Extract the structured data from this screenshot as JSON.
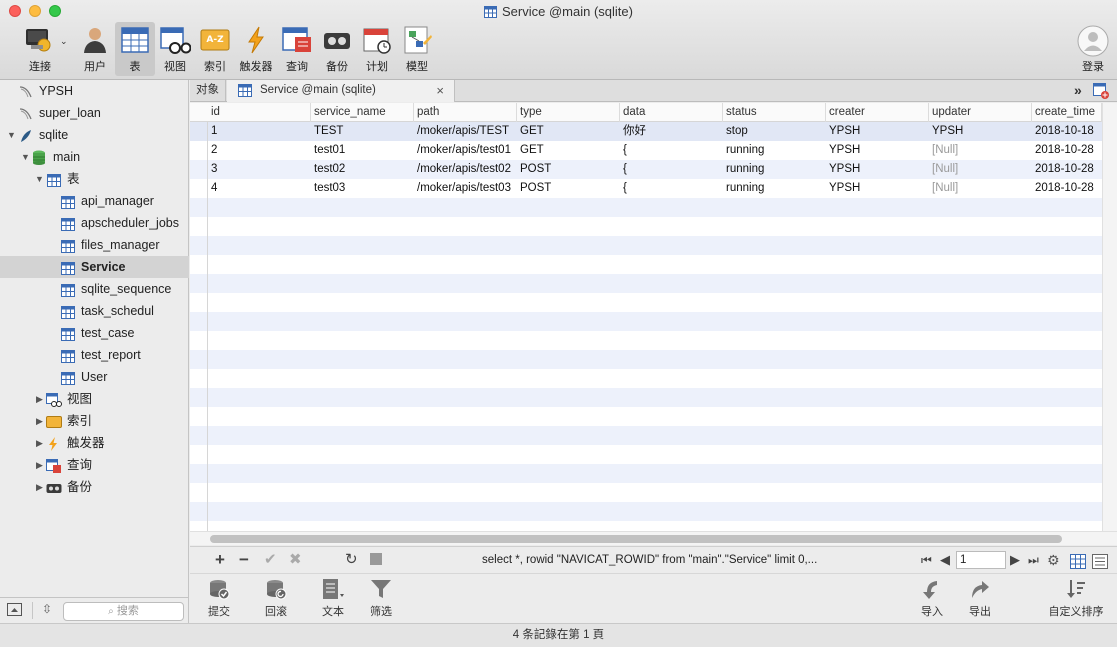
{
  "window": {
    "title": "Service @main (sqlite)"
  },
  "toolbar": {
    "items": [
      {
        "label": "连接",
        "icon": "connection-icon"
      },
      {
        "label": "用户",
        "icon": "user-icon"
      },
      {
        "label": "表",
        "icon": "table-icon",
        "active": true
      },
      {
        "label": "视图",
        "icon": "view-icon"
      },
      {
        "label": "索引",
        "icon": "index-icon"
      },
      {
        "label": "触发器",
        "icon": "trigger-icon"
      },
      {
        "label": "查询",
        "icon": "query-icon"
      },
      {
        "label": "备份",
        "icon": "backup-icon"
      },
      {
        "label": "计划",
        "icon": "schedule-icon"
      },
      {
        "label": "模型",
        "icon": "model-icon"
      }
    ],
    "login_label": "登录"
  },
  "sidebar": {
    "connections": [
      "YPSH",
      "super_loan",
      "sqlite"
    ],
    "database": "main",
    "tables_label": "表",
    "tables": [
      "api_manager",
      "apscheduler_jobs",
      "files_manager",
      "Service",
      "sqlite_sequence",
      "task_schedul",
      "test_case",
      "test_report",
      "User"
    ],
    "selected_table": "Service",
    "groups": [
      "视图",
      "索引",
      "触发器",
      "查询",
      "备份"
    ],
    "search_placeholder": "搜索"
  },
  "tabs": {
    "objects_label": "对象",
    "active_tab": "Service @main (sqlite)"
  },
  "grid": {
    "columns": [
      "id",
      "service_name",
      "path",
      "type",
      "data",
      "status",
      "creater",
      "updater",
      "create_time"
    ],
    "rows": [
      [
        "1",
        "TEST",
        "/moker/apis/TEST",
        "GET",
        "你好",
        "stop",
        "YPSH",
        "YPSH",
        "2018-10-18"
      ],
      [
        "2",
        "test01",
        "/moker/apis/test01",
        "GET",
        "{",
        "running",
        "YPSH",
        "[Null]",
        "2018-10-28"
      ],
      [
        "3",
        "test02",
        "/moker/apis/test02",
        "POST",
        "{",
        "running",
        "YPSH",
        "[Null]",
        "2018-10-28"
      ],
      [
        "4",
        "test03",
        "/moker/apis/test03",
        "POST",
        "{",
        "running",
        "YPSH",
        "[Null]",
        "2018-10-28"
      ]
    ]
  },
  "statusbar": {
    "sql": "select *, rowid \"NAVICAT_ROWID\" from \"main\".\"Service\"  limit 0,...",
    "page": "1"
  },
  "actions": {
    "commit": "提交",
    "rollback": "回滚",
    "text": "文本",
    "filter": "筛选",
    "import": "导入",
    "export": "导出",
    "sort": "自定义排序"
  },
  "footer": {
    "text": "4 条記錄在第 1 頁"
  },
  "colors": {
    "row_alt": "#edf1fb",
    "row_selected": "#e1e7f5",
    "close": "#fc605c",
    "minimize": "#fdbc40",
    "maximize": "#34c84a"
  }
}
